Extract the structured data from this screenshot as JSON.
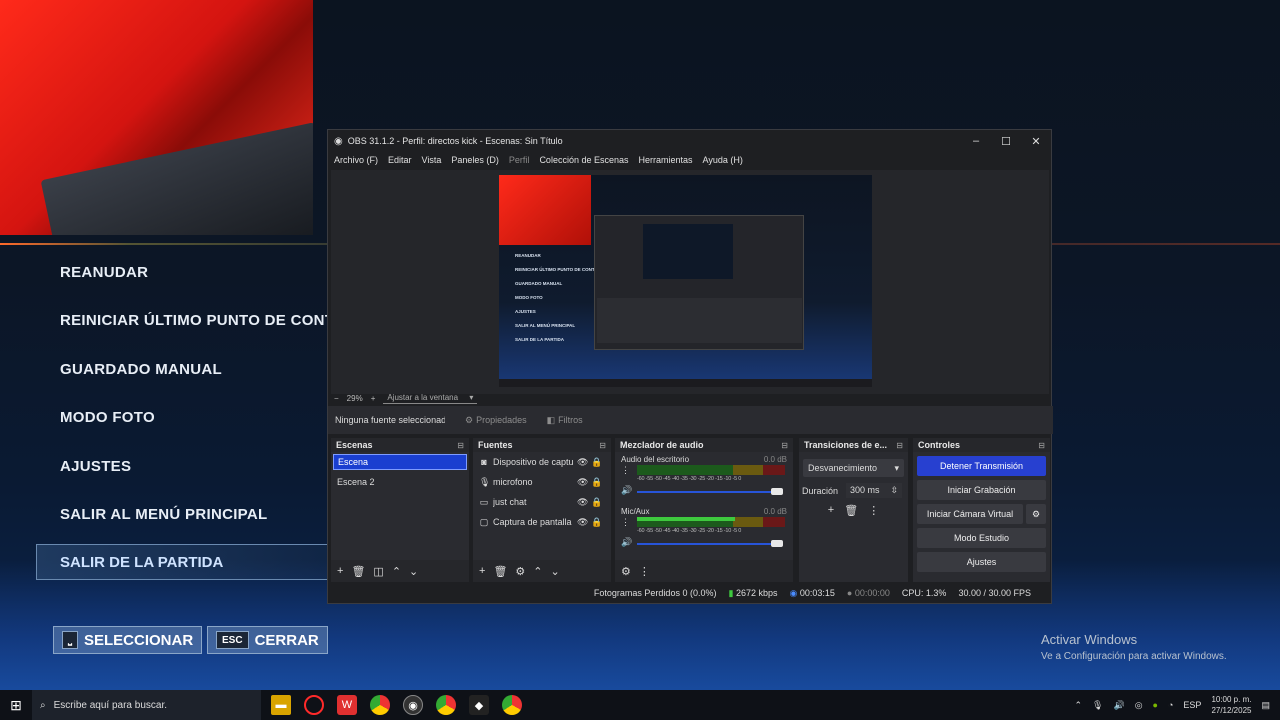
{
  "game": {
    "menu": [
      "REANUDAR",
      "REINICIAR ÚLTIMO PUNTO DE CONTR",
      "GUARDADO MANUAL",
      "MODO FOTO",
      "AJUSTES",
      "SALIR AL MENÚ PRINCIPAL"
    ],
    "selected": "SALIR DE LA PARTIDA",
    "select_key": "⎵",
    "select_label": "SELECCIONAR",
    "close_key": "ESC",
    "close_label": "CERRAR"
  },
  "activate": {
    "title": "Activar Windows",
    "sub": "Ve a Configuración para activar Windows."
  },
  "obs": {
    "title": "OBS 31.1.2 - Perfil: directos kick - Escenas: Sin Título",
    "menu": [
      "Archivo (F)",
      "Editar",
      "Vista",
      "Paneles (D)",
      "Perfil",
      "Colección de Escenas",
      "Herramientas",
      "Ayuda (H)"
    ],
    "zoom": "29%",
    "fit": "Ajustar a la ventana",
    "no_source": "Ninguna fuente seleccionada",
    "properties": "Propiedades",
    "filters": "Filtros",
    "scenes_title": "Escenas",
    "scenes": [
      "Escena",
      "Escena 2"
    ],
    "sources_title": "Fuentes",
    "sources": [
      "Dispositivo de captura",
      "microfono",
      "just chat",
      "Captura de pantalla"
    ],
    "mixer_title": "Mezclador de audio",
    "channels": [
      {
        "name": "Audio del escritorio",
        "db": "0.0 dB",
        "level": 0.0
      },
      {
        "name": "Mic/Aux",
        "db": "0.0 dB",
        "level": 0.66
      }
    ],
    "scale": "-60 -55 -50 -45 -40 -35 -30 -25 -20 -15 -10 -5 0",
    "transitions_title": "Transiciones de e...",
    "transition": "Desvanecimiento",
    "duration_label": "Duración",
    "duration": "300 ms",
    "controls_title": "Controles",
    "controls": [
      "Detener Transmisión",
      "Iniciar Grabación",
      "Iniciar Cámara Virtual",
      "Modo Estudio",
      "Ajustes"
    ],
    "status": {
      "dropped": "Fotogramas Perdidos 0 (0.0%)",
      "bitrate": "2672 kbps",
      "live": "00:03:15",
      "rec": "00:00:00",
      "cpu": "CPU: 1.3%",
      "fps": "30.00 / 30.00 FPS"
    },
    "preview_menu": [
      "REANUDAR",
      "REINICIAR ÚLTIMO PUNTO DE CONTR",
      "GUARDADO MANUAL",
      "MODO FOTO",
      "AJUSTES",
      "SALIR AL MENÚ PRINCIPAL",
      "SALIR DE LA PARTIDA"
    ]
  },
  "taskbar": {
    "search_placeholder": "Escribe aquí para buscar.",
    "lang": "ESP",
    "time": "10:00 p. m.",
    "date": "27/12/2025"
  }
}
